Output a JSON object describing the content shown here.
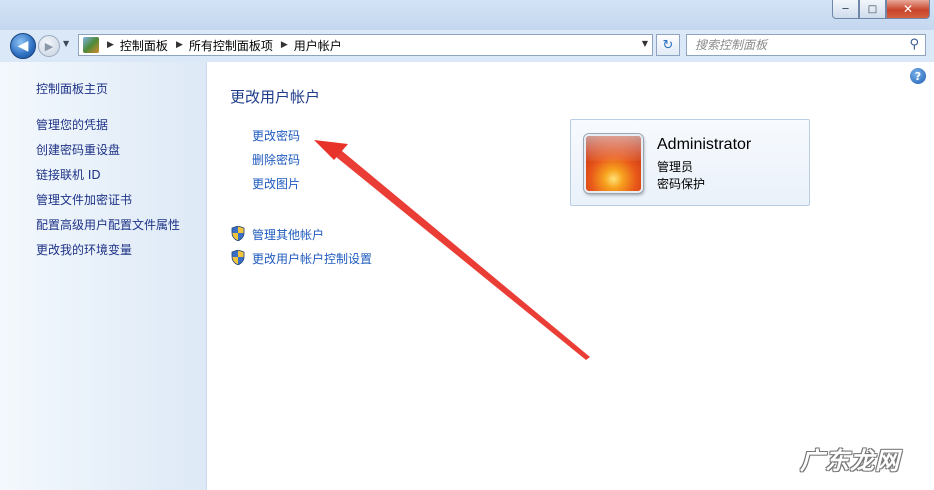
{
  "window": {
    "minimize_glyph": "─",
    "maximize_glyph": "□",
    "close_glyph": "✕"
  },
  "toolbar": {
    "back_glyph": "◀",
    "forward_glyph": "▶",
    "breadcrumbs": [
      "控制面板",
      "所有控制面板项",
      "用户帐户"
    ],
    "search_placeholder": "搜索控制面板",
    "refresh_glyph": "↻",
    "search_glyph": "⚲"
  },
  "sidebar": {
    "home_link": "控制面板主页",
    "items": [
      {
        "label": "管理您的凭据"
      },
      {
        "label": "创建密码重设盘"
      },
      {
        "label": "链接联机 ID"
      },
      {
        "label": "管理文件加密证书"
      },
      {
        "label": "配置高级用户配置文件属性"
      },
      {
        "label": "更改我的环境变量"
      }
    ]
  },
  "main": {
    "title": "更改用户帐户",
    "help_glyph": "?",
    "tasks": [
      {
        "label": "更改密码"
      },
      {
        "label": "删除密码"
      },
      {
        "label": "更改图片"
      }
    ],
    "shield_tasks": [
      {
        "label": "管理其他帐户"
      },
      {
        "label": "更改用户帐户控制设置"
      }
    ],
    "account": {
      "name": "Administrator",
      "role": "管理员",
      "status": "密码保护"
    }
  },
  "annotation": {
    "arrow_color": "#e8332a"
  },
  "watermark": "广东龙网"
}
